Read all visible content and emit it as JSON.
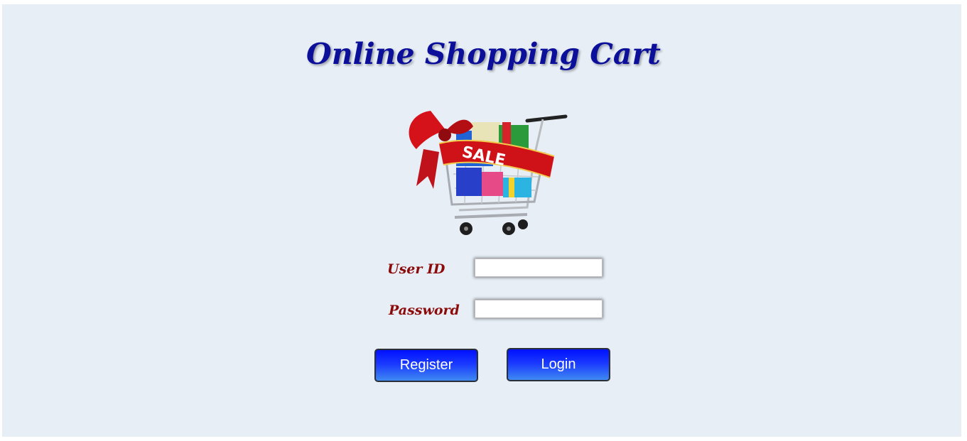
{
  "page": {
    "title": "Online Shopping Cart",
    "background_color": "#e7eef6"
  },
  "hero_image": {
    "name": "shopping-cart-sale",
    "ribbon_text": "SALE"
  },
  "login_form": {
    "user_id": {
      "label": "User ID",
      "value": ""
    },
    "password": {
      "label": "Password",
      "value": ""
    },
    "register_label": "Register",
    "login_label": "Login"
  },
  "colors": {
    "title": "#0b0f9a",
    "label": "#8b0a0a",
    "button_top": "#0011ff",
    "button_bottom": "#3f8af2"
  }
}
